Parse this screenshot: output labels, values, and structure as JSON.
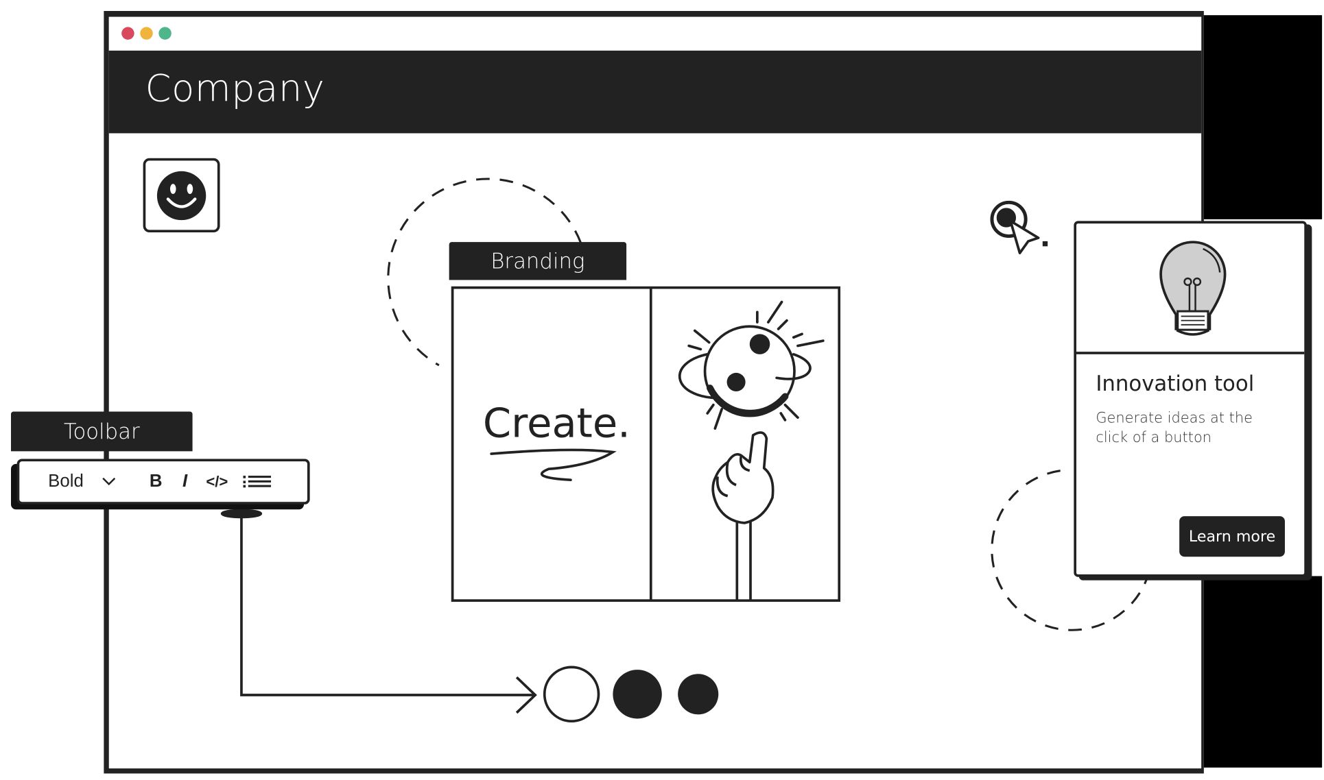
{
  "window": {
    "dots": [
      "#d9485c",
      "#f0b43c",
      "#4fb58d"
    ],
    "header_title": "Company"
  },
  "branding": {
    "tab_label": "Branding",
    "panel_text": "Create."
  },
  "toolbar": {
    "tab_label": "Toolbar",
    "font_weight_select": "Bold",
    "icons": [
      "chevron-down-icon",
      "bold-icon",
      "italic-icon",
      "code-icon",
      "list-icon"
    ],
    "bold_label": "B",
    "italic_label": "I",
    "code_label": "</>"
  },
  "card": {
    "title": "Innovation tool",
    "description": "Generate ideas at the click of a button",
    "button_label": "Learn more"
  },
  "colors": {
    "dark": "#222222",
    "bulb_fill": "#cfcfcf"
  }
}
